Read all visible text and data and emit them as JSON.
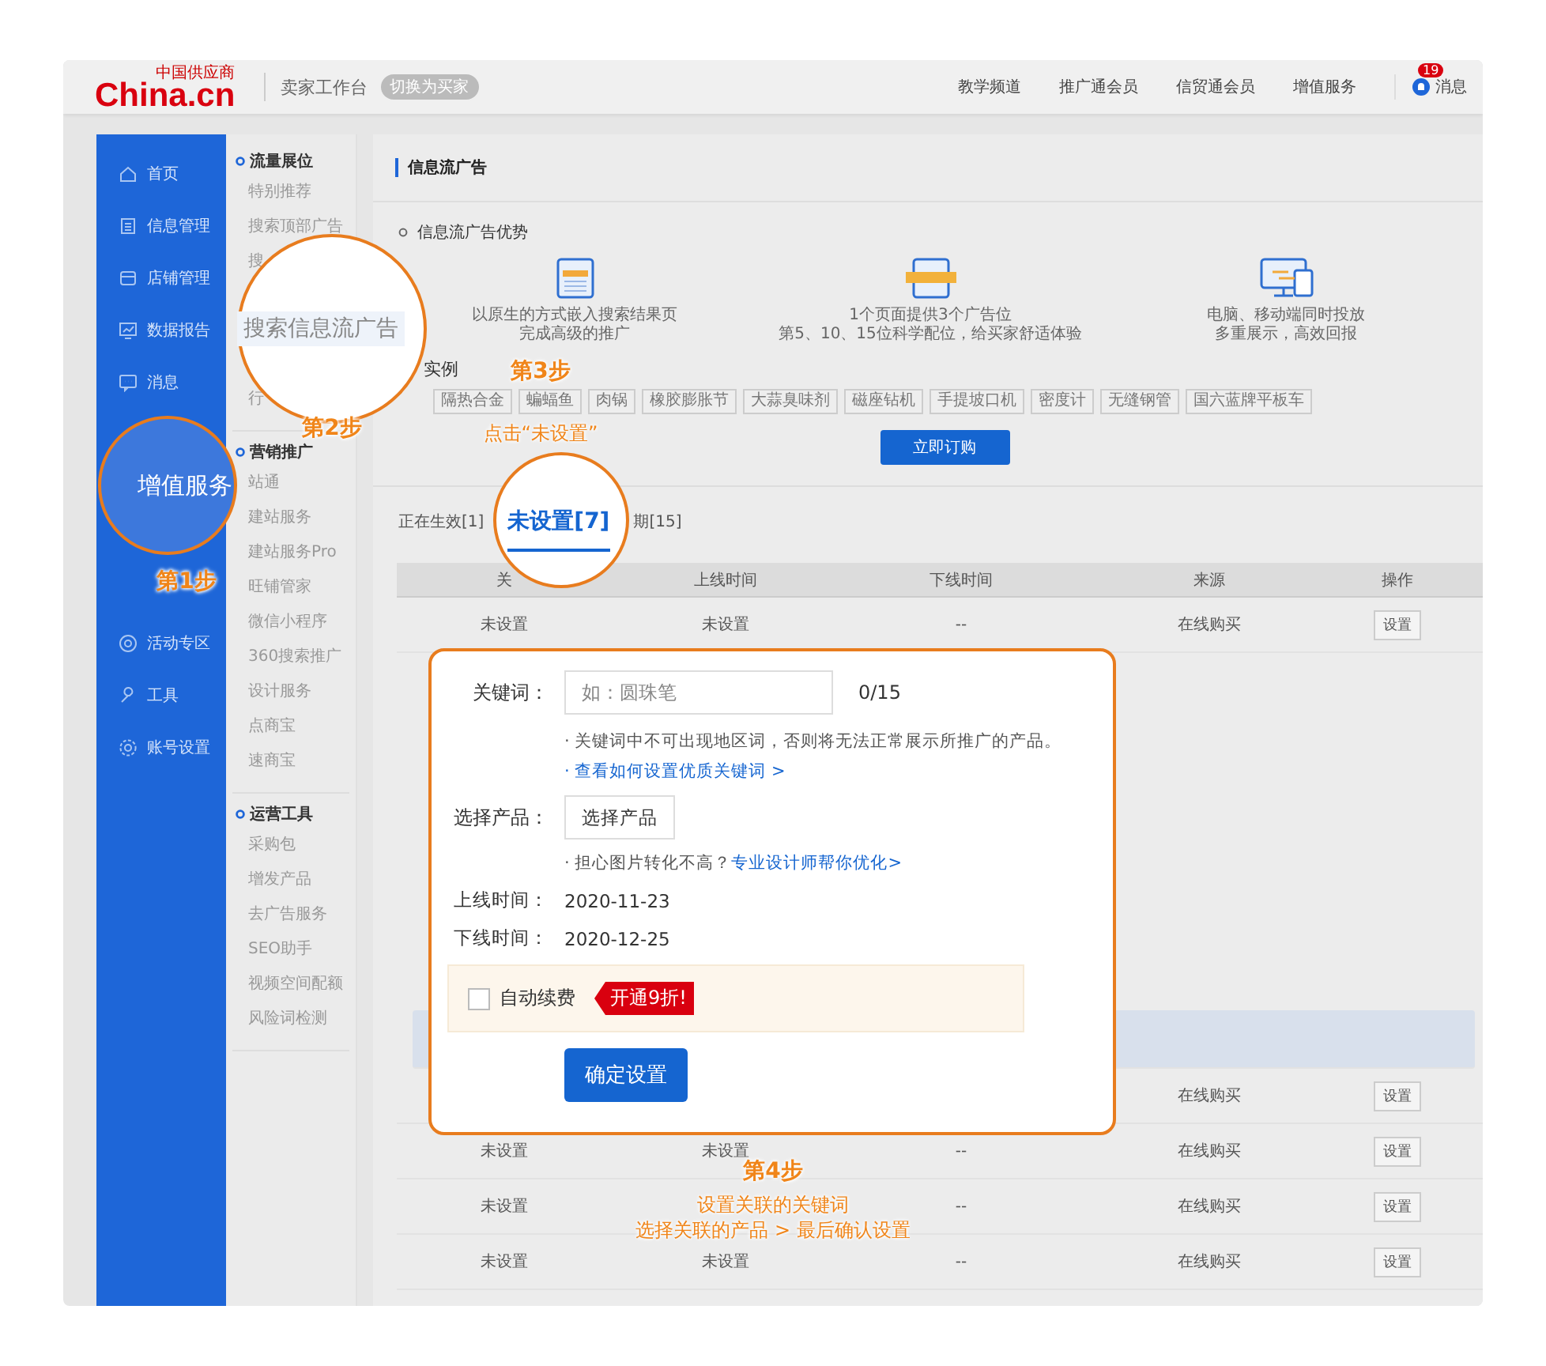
{
  "header": {
    "logo": "China.cn",
    "logo_tagline": "中国供应商",
    "title": "卖家工作台",
    "switch_button": "切换为买家",
    "nav": [
      "教学频道",
      "推广通会员",
      "信贸通会员",
      "增值服务"
    ],
    "messages": {
      "badge": "19",
      "label": "消息"
    }
  },
  "sidebar": {
    "items": [
      {
        "label": "首页",
        "selected": false
      },
      {
        "label": "信息管理",
        "selected": false
      },
      {
        "label": "店铺管理",
        "selected": false
      },
      {
        "label": "数据报告",
        "selected": false
      },
      {
        "label": "消息",
        "selected": false
      },
      {
        "label": "增值服务",
        "selected": true
      },
      {
        "label": "活动专区",
        "selected": false
      },
      {
        "label": "工具",
        "selected": false
      },
      {
        "label": "账号设置",
        "selected": false
      }
    ]
  },
  "subnav": {
    "groups": [
      {
        "title": "流量展位",
        "items": [
          {
            "label": "特别推荐",
            "selected": false
          },
          {
            "label": "搜索顶部广告",
            "selected": false
          },
          {
            "label": "搜",
            "selected": false
          },
          {
            "label": "搜索信息流广告",
            "selected": true
          },
          {
            "label": "行",
            "selected": false
          }
        ]
      },
      {
        "title": "营销推广",
        "items": [
          {
            "label": "站通",
            "selected": false
          },
          {
            "label": "建站服务",
            "selected": false
          },
          {
            "label": "建站服务Pro",
            "selected": false
          },
          {
            "label": "旺铺管家",
            "selected": false
          },
          {
            "label": "微信小程序",
            "selected": false
          },
          {
            "label": "360搜索推广",
            "selected": false
          },
          {
            "label": "设计服务",
            "selected": false
          },
          {
            "label": "点商宝",
            "selected": false
          },
          {
            "label": "速商宝",
            "selected": false
          }
        ]
      },
      {
        "title": "运营工具",
        "items": [
          {
            "label": "采购包",
            "selected": false
          },
          {
            "label": "增发产品",
            "selected": false
          },
          {
            "label": "去广告服务",
            "selected": false
          },
          {
            "label": "SEO助手",
            "selected": false
          },
          {
            "label": "视频空间配额",
            "selected": false
          },
          {
            "label": "风险词检测",
            "selected": false
          }
        ]
      }
    ]
  },
  "page": {
    "title": "信息流广告",
    "advantages": {
      "title": "信息流广告优势",
      "features": [
        {
          "lines": [
            "以原生的方式嵌入搜索结果页",
            "完成高级的推广"
          ]
        },
        {
          "lines": [
            "1个页面提供3个广告位",
            "第5、10、15位科学配位，给买家舒适体验"
          ]
        },
        {
          "lines": [
            "电脑、移动端同时投放",
            "多重展示，高效回报"
          ]
        }
      ]
    },
    "examples": {
      "title": "实例",
      "tags": [
        "隔热合金",
        "蝙蝠鱼",
        "肉锅",
        "橡胶膨胀节",
        "大蒜臭味剂",
        "磁座钻机",
        "手提坡口机",
        "密度计",
        "无缝钢管",
        "国六蓝牌平板车"
      ]
    },
    "order_button": "立即订购"
  },
  "tabs": [
    {
      "label": "正在生效[1]",
      "selected": false
    },
    {
      "label": "未设置[7]",
      "selected": true
    },
    {
      "label": "期[15]",
      "selected": false
    }
  ],
  "table": {
    "columns": [
      "关",
      "上线时间",
      "下线时间",
      "来源",
      "操作"
    ],
    "rows": [
      {
        "keyword": "未设置",
        "start": "未设置",
        "end": "--",
        "source": "在线购买",
        "action": "设置",
        "selected": false
      },
      {
        "selected": true
      },
      {
        "source": "在线购买",
        "action": "设置",
        "selected": false
      },
      {
        "keyword": "未设置",
        "start": "未设置",
        "end": "--",
        "source": "在线购买",
        "action": "设置",
        "selected": false
      },
      {
        "keyword": "未设置",
        "end": "--",
        "source": "在线购买",
        "action": "设置",
        "selected": false
      },
      {
        "keyword": "未设置",
        "start": "未设置",
        "end": "--",
        "source": "在线购买",
        "action": "设置",
        "selected": false
      }
    ]
  },
  "dialog": {
    "keyword": {
      "label": "关键词：",
      "placeholder": "如：圆珠笔",
      "counter": "0/15"
    },
    "keyword_note": "· 关键词中不可出现地区词，否则将无法正常展示所推广的产品。",
    "keyword_link": "· 查看如何设置优质关键词 >",
    "product": {
      "label": "选择产品：",
      "button": "选择产品"
    },
    "design_note": "· 担心图片转化不高？",
    "design_link": "专业设计师帮你优化>",
    "start": {
      "label": "上线时间：",
      "value": "2020-11-23"
    },
    "end": {
      "label": "下线时间：",
      "value": "2020-12-25"
    },
    "auto_renew": {
      "label": "自动续费",
      "checked": false,
      "promo": "开通9折!"
    },
    "confirm": "确定设置"
  },
  "steps": [
    {
      "title": "第1步"
    },
    {
      "title": "第2步"
    },
    {
      "title": "第3步",
      "lines": [
        "点击“未设置”"
      ]
    },
    {
      "title": "第4步",
      "lines": [
        "设置关联的关键词",
        "选择关联的产品 > 最后确认设置"
      ]
    }
  ]
}
